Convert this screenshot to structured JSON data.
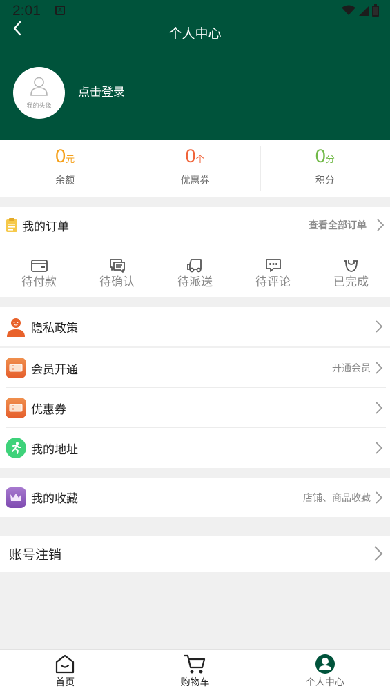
{
  "status_bar": {
    "time": "2:01",
    "notice_badge": "A"
  },
  "header": {
    "title": "个人中心",
    "avatar_caption": "我的头像",
    "login_text": "点击登录"
  },
  "stats": [
    {
      "value": "0",
      "unit": "元",
      "label": "余额",
      "color": "#f5a01a"
    },
    {
      "value": "0",
      "unit": "个",
      "label": "优惠券",
      "color": "#f0643a"
    },
    {
      "value": "0",
      "unit": "分",
      "label": "积分",
      "color": "#71b948"
    }
  ],
  "orders": {
    "title": "我的订单",
    "view_all": "查看全部订单",
    "items": [
      {
        "label": "待付款",
        "icon": "wallet-icon"
      },
      {
        "label": "待确认",
        "icon": "chat-icon"
      },
      {
        "label": "待派送",
        "icon": "truck-icon"
      },
      {
        "label": "待评论",
        "icon": "comment-icon"
      },
      {
        "label": "已完成",
        "icon": "done-bag-icon"
      }
    ]
  },
  "menu": {
    "privacy": {
      "label": "隐私政策",
      "icon": "person-icon"
    },
    "membership": {
      "label": "会员开通",
      "extra": "开通会员",
      "icon": "ticket-icon"
    },
    "coupons": {
      "label": "优惠券",
      "icon": "ticket-icon"
    },
    "address": {
      "label": "我的地址",
      "icon": "runner-icon"
    },
    "favorites": {
      "label": "我的收藏",
      "extra": "店铺、商品收藏",
      "icon": "crown-icon"
    },
    "account": {
      "label": "账号注销"
    }
  },
  "tabbar": [
    {
      "label": "首页",
      "icon": "home-icon",
      "active": false
    },
    {
      "label": "购物车",
      "icon": "cart-icon",
      "active": false
    },
    {
      "label": "个人中心",
      "icon": "profile-icon",
      "active": true
    }
  ],
  "colors": {
    "header_bg": "#00533b",
    "background": "#f0f0f0"
  }
}
